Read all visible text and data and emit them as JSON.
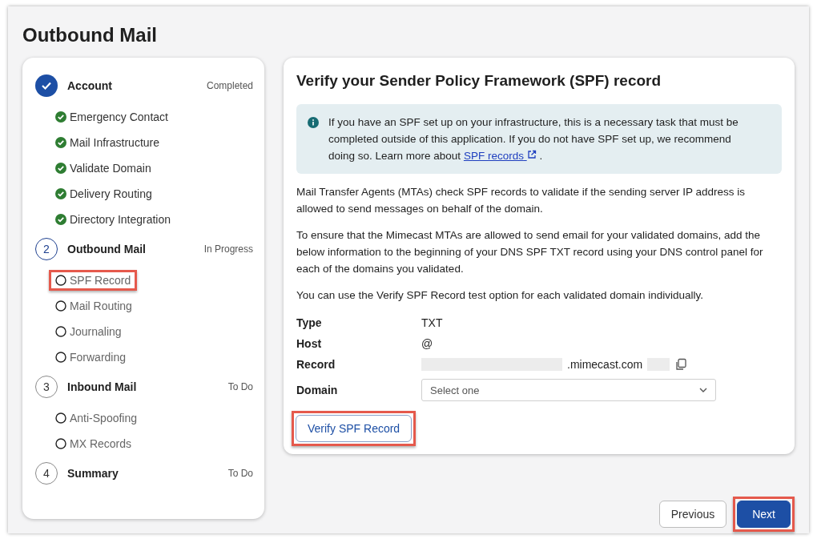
{
  "page": {
    "title": "Outbound Mail"
  },
  "steps": [
    {
      "kind": "completed",
      "label": "Account",
      "status_text": "Completed",
      "substeps": [
        {
          "label": "Emergency Contact",
          "done": true,
          "highlighted": false
        },
        {
          "label": "Mail Infrastructure",
          "done": true,
          "highlighted": false
        },
        {
          "label": "Validate Domain",
          "done": true,
          "highlighted": false
        },
        {
          "label": "Delivery Routing",
          "done": true,
          "highlighted": false
        },
        {
          "label": "Directory Integration",
          "done": true,
          "highlighted": false
        }
      ]
    },
    {
      "kind": "in_progress",
      "number": "2",
      "label": "Outbound Mail",
      "status_text": "In Progress",
      "substeps": [
        {
          "label": "SPF Record",
          "done": false,
          "highlighted": true
        },
        {
          "label": "Mail Routing",
          "done": false,
          "highlighted": false
        },
        {
          "label": "Journaling",
          "done": false,
          "highlighted": false
        },
        {
          "label": "Forwarding",
          "done": false,
          "highlighted": false
        }
      ]
    },
    {
      "kind": "todo",
      "number": "3",
      "label": "Inbound Mail",
      "status_text": "To Do",
      "substeps": [
        {
          "label": "Anti-Spoofing",
          "done": false,
          "highlighted": false
        },
        {
          "label": "MX Records",
          "done": false,
          "highlighted": false
        }
      ]
    },
    {
      "kind": "todo",
      "number": "4",
      "label": "Summary",
      "status_text": "To Do"
    }
  ],
  "panel": {
    "title": "Verify your Sender Policy Framework (SPF) record",
    "info": {
      "text": "If you have an SPF set up on your infrastructure, this is a necessary task that must be completed outside of this application. If you do not have SPF set up, we recommend doing so. Learn more about",
      "link": "SPF records",
      "after": "."
    },
    "paragraphs": [
      "Mail Transfer Agents (MTAs) check SPF records to validate if the sending server IP address is allowed to send messages on behalf of the domain.",
      "To ensure that the Mimecast MTAs are allowed to send email for your validated domains, add the below information to the beginning of your DNS SPF TXT record using your DNS control panel for each of the domains you validated.",
      "You can use the Verify SPF Record test option for each validated domain individually."
    ],
    "fields": [
      {
        "kind": "text",
        "label": "Type",
        "value": "TXT"
      },
      {
        "kind": "text",
        "label": "Host",
        "value": "@"
      },
      {
        "kind": "record",
        "label": "Record",
        "value": ".mimecast.com"
      },
      {
        "kind": "select",
        "label": "Domain",
        "placeholder": "Select one"
      }
    ],
    "verify_button": {
      "label": "Verify SPF Record",
      "highlighted": true
    }
  },
  "footer_buttons": [
    {
      "kind": "secondary",
      "label": "Previous",
      "highlighted": false
    },
    {
      "kind": "primary",
      "label": "Next",
      "highlighted": true
    }
  ]
}
